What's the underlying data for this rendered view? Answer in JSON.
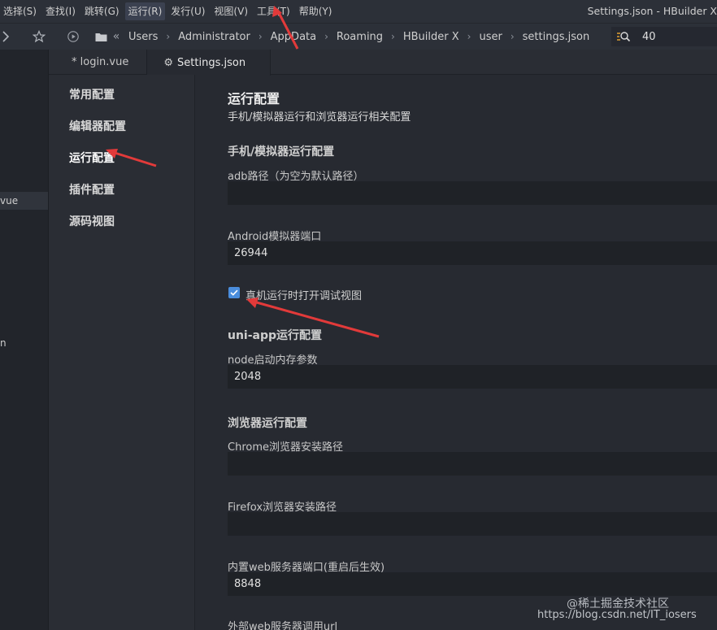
{
  "menubar": {
    "items": [
      "选择(S)",
      "查找(I)",
      "跳转(G)",
      "运行(R)",
      "发行(U)",
      "视图(V)",
      "工具(T)",
      "帮助(Y)"
    ],
    "active_index": 3,
    "window_title": "Settings.json - HBuilder X"
  },
  "toolbar": {
    "breadcrumbs": [
      "Users",
      "Administrator",
      "AppData",
      "Roaming",
      "HBuilder X",
      "user",
      "settings.json"
    ],
    "zoom_value": "40",
    "icons": [
      "chevron-right-icon",
      "star-icon",
      "play-circle-icon",
      "folder-icon",
      "double-chevron-left-icon",
      "zoom-search-icon"
    ]
  },
  "left_strip": {
    "visible_item": "vue",
    "fragment": "n"
  },
  "tabs": [
    {
      "label": "* login.vue",
      "active": false
    },
    {
      "label": "Settings.json",
      "active": true,
      "icon": "gear-icon"
    }
  ],
  "settings_nav": {
    "items": [
      "常用配置",
      "编辑器配置",
      "运行配置",
      "插件配置",
      "源码视图"
    ],
    "active_index": 2
  },
  "content": {
    "title": "运行配置",
    "description": "手机/模拟器运行和浏览器运行相关配置",
    "group_mobile": "手机/模拟器运行配置",
    "adb_label": "adb路径（为空为默认路径）",
    "adb_value": "",
    "android_port_label": "Android模拟器端口",
    "android_port_value": "26944",
    "debug_checkbox_label": "真机运行时打开调试视图",
    "debug_checkbox_checked": true,
    "group_uniapp": "uni-app运行配置",
    "node_mem_label": "node启动内存参数",
    "node_mem_value": "2048",
    "group_browser": "浏览器运行配置",
    "chrome_label": "Chrome浏览器安装路径",
    "chrome_value": "",
    "firefox_label": "Firefox浏览器安装路径",
    "firefox_value": "",
    "web_port_label": "内置web服务器端口(重启后生效)",
    "web_port_value": "8848",
    "external_url_label": "外部web服务器调用url"
  },
  "watermark": {
    "line1": "@稀土掘金技术社区",
    "line2": "https://blog.csdn.net/IT_iosers"
  },
  "colors": {
    "accent": "#4a8ddc",
    "annotation_arrow": "#e23a3a"
  }
}
